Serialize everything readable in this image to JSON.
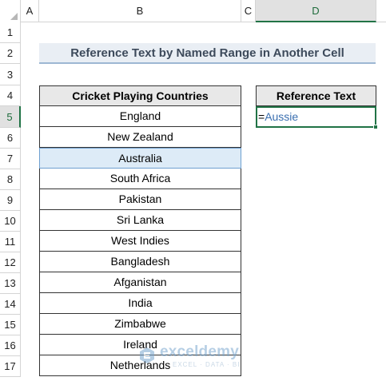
{
  "columns": [
    "A",
    "B",
    "C",
    "D"
  ],
  "selected_column": "D",
  "rows": [
    "1",
    "2",
    "3",
    "4",
    "5",
    "6",
    "7",
    "8",
    "9",
    "10",
    "11",
    "12",
    "13",
    "14",
    "15",
    "16",
    "17"
  ],
  "selected_row": "5",
  "title": "Reference Text by Named Range in Another Cell",
  "table": {
    "header": "Cricket Playing Countries",
    "items": [
      "England",
      "New Zealand",
      "Australia",
      "South Africa",
      "Pakistan",
      "Sri Lanka",
      "West Indies",
      "Bangladesh",
      "Afganistan",
      "India",
      "Zimbabwe",
      "Ireland",
      "Netherlands"
    ],
    "highlighted_item": "Australia"
  },
  "reference": {
    "header": "Reference Text",
    "formula_prefix": "=",
    "formula_name": "Aussie"
  },
  "watermark": {
    "name": "exceldemy",
    "tagline": "EXCEL · DATA · BI"
  },
  "colors": {
    "accent_green": "#217346",
    "name_blue": "#3a6fb0",
    "title_bg": "#e9eef4",
    "highlight_bg": "#ddebf7"
  },
  "icons": {
    "select_all": "select-all-triangle-icon",
    "fill_handle": "fill-handle-icon",
    "watermark_logo": "exceldemy-logo-icon"
  }
}
